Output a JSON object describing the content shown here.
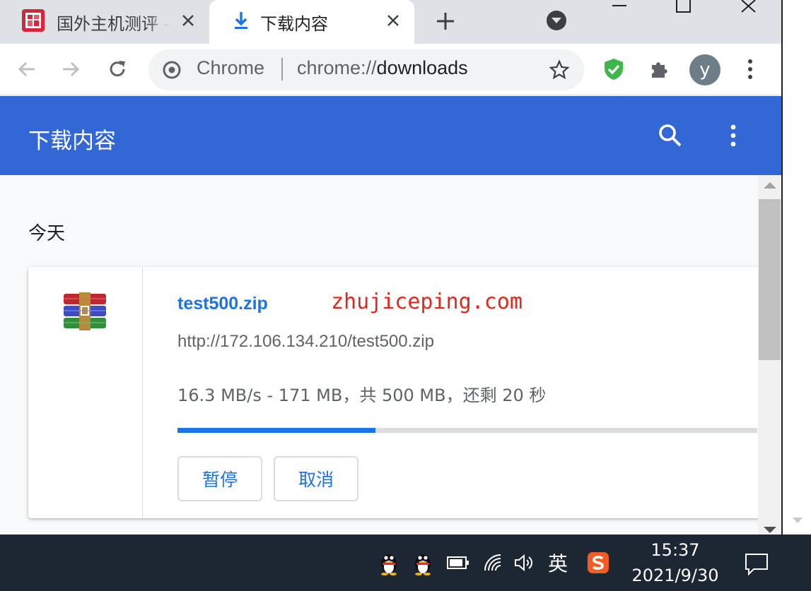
{
  "tabs": [
    {
      "title": "国外主机测评 - ",
      "favicon": "site-logo-icon",
      "active": false
    },
    {
      "title": "下载内容",
      "favicon": "download-icon",
      "active": true
    }
  ],
  "toolbar": {
    "origin": "Chrome",
    "url_scheme": "chrome://",
    "url_host": "downloads",
    "avatar_letter": "y"
  },
  "downloads_page": {
    "title": "下载内容",
    "date_header": "今天",
    "items": [
      {
        "file_name": "test500.zip",
        "watermark": "zhujiceping.com",
        "url": "http://172.106.134.210/test500.zip",
        "progress_text": "16.3 MB/s - 171 MB，共 500 MB，还剩 20 秒",
        "progress_fraction": 0.342,
        "pause_label": "暂停",
        "cancel_label": "取消",
        "icon": "winrar-archive-icon"
      }
    ]
  },
  "taskbar": {
    "ime_label": "英",
    "time": "15:37",
    "date": "2021/9/30"
  },
  "colors": {
    "header_blue": "#3367d6",
    "link_blue": "#1a73e8",
    "watermark_red": "#e8251b",
    "taskbar": "#1d2733"
  }
}
